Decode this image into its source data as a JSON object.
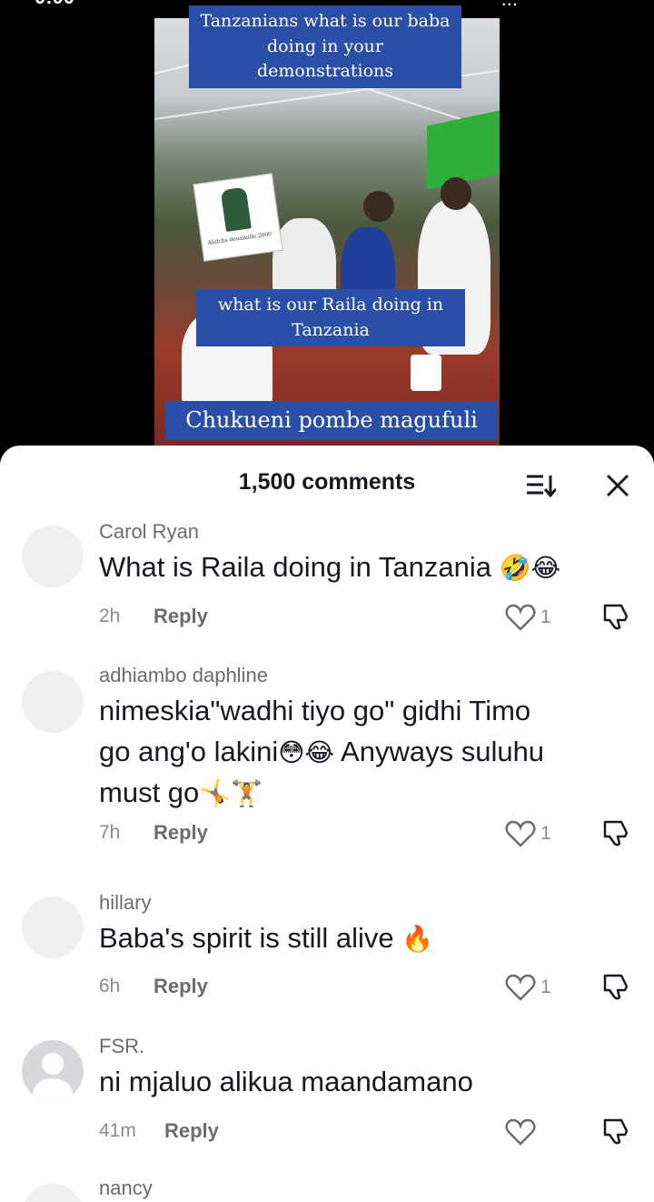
{
  "status_bar": {
    "time": "0:00",
    "signal": "...",
    "battery": ""
  },
  "video": {
    "caption_top": "Tanzanians what is our baba doing in your demonstrations",
    "poster_text": "Alidchs deuxmille 2000",
    "caption_middle": "what is our Raila doing in Tanzania",
    "caption_bottom": "Chukueni pombe magufuli"
  },
  "sheet": {
    "comments_count": "1,500 comments",
    "sort_icon": "sort-icon",
    "close_icon": "close-icon"
  },
  "comments": [
    {
      "username": "Carol Ryan",
      "text": "What is Raila doing in Tanzania",
      "emoji": "🤣😂",
      "time": "2h",
      "reply": "Reply",
      "likes": "1"
    },
    {
      "username": "adhiambo  daphline",
      "text_line1": "nimeskia\"wadhi tiyo go\" gidhi Timo",
      "text_line2": "go ang'o lakini",
      "emoji_mid": "😳😂",
      "text_line2b": " Anyways suluhu",
      "text_line3": "must go",
      "emoji_end": "🤸🏋",
      "time": "7h",
      "reply": "Reply",
      "likes": "1"
    },
    {
      "username": "hillary",
      "text": "Baba's spirit is still alive",
      "emoji": "🔥",
      "time": "6h",
      "reply": "Reply",
      "likes": "1"
    },
    {
      "username": "FSR.",
      "text": "ni mjaluo alikua maandamano",
      "time": "41m",
      "reply": "Reply",
      "likes": ""
    },
    {
      "username": "nancy"
    }
  ]
}
